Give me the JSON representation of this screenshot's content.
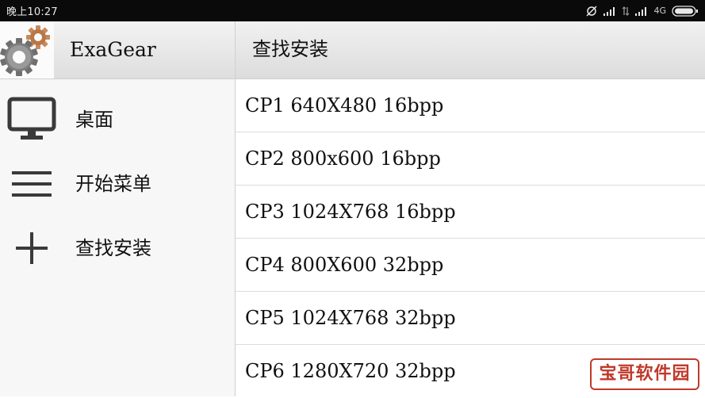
{
  "status_bar": {
    "time": "晚上10:27",
    "network": "4G",
    "colors": {
      "background": "#0a0a0a",
      "text": "#e8e8e8"
    }
  },
  "app": {
    "title": "ExaGear",
    "logo_icon": "gears-icon"
  },
  "page": {
    "title": "查找安装"
  },
  "sidebar": {
    "items": [
      {
        "icon": "monitor-icon",
        "label": "桌面"
      },
      {
        "icon": "menu-lines-icon",
        "label": "开始菜单"
      },
      {
        "icon": "plus-icon",
        "label": "查找安装"
      }
    ]
  },
  "list": {
    "items": [
      {
        "label": "CP1 640X480 16bpp"
      },
      {
        "label": "CP2 800x600 16bpp"
      },
      {
        "label": "CP3 1024X768 16bpp"
      },
      {
        "label": "CP4 800X600 32bpp"
      },
      {
        "label": "CP5 1024X768 32bpp"
      },
      {
        "label": "CP6 1280X720 32bpp"
      }
    ]
  },
  "watermark": {
    "text": "宝哥软件园",
    "color": "#c0392b"
  }
}
